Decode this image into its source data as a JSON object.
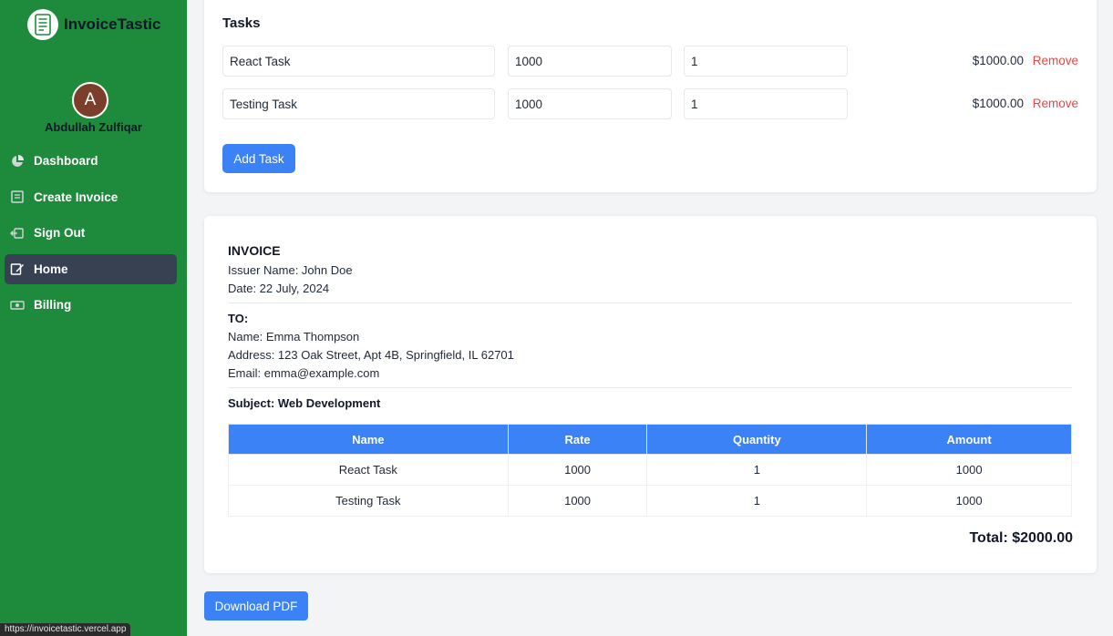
{
  "app": {
    "name": "InvoiceTastic"
  },
  "user": {
    "initial": "A",
    "name": "Abdullah Zulfiqar"
  },
  "nav": {
    "items": [
      {
        "label": "Dashboard",
        "icon": "pie-chart-icon"
      },
      {
        "label": "Create Invoice",
        "icon": "document-icon"
      },
      {
        "label": "Sign Out",
        "icon": "sign-out-icon"
      },
      {
        "label": "Home",
        "icon": "edit-icon",
        "active": true
      },
      {
        "label": "Billing",
        "icon": "money-icon"
      }
    ]
  },
  "tasks": {
    "title": "Tasks",
    "rows": [
      {
        "name": "React Task",
        "rate": "1000",
        "quantity": "1",
        "amount": "$1000.00",
        "remove_label": "Remove"
      },
      {
        "name": "Testing Task",
        "rate": "1000",
        "quantity": "1",
        "amount": "$1000.00",
        "remove_label": "Remove"
      }
    ],
    "add_label": "Add Task"
  },
  "invoice": {
    "title": "INVOICE",
    "issuer": "Issuer Name: John Doe",
    "date": "Date: 22 July, 2024",
    "to_label": "TO:",
    "to_name": "Name: Emma Thompson",
    "to_address": "Address: 123 Oak Street, Apt 4B, Springfield, IL 62701",
    "to_email": "Email: emma@example.com",
    "subject": "Subject: Web Development",
    "table": {
      "headers": [
        "Name",
        "Rate",
        "Quantity",
        "Amount"
      ],
      "rows": [
        [
          "React Task",
          "1000",
          "1",
          "1000"
        ],
        [
          "Testing Task",
          "1000",
          "1",
          "1000"
        ]
      ]
    },
    "total": "Total: $2000.00"
  },
  "download_label": "Download PDF",
  "status_url": "https://invoicetastic.vercel.app",
  "colors": {
    "sidebar": "#1e8a3b",
    "active_nav": "#374151",
    "primary": "#3b82f6",
    "danger": "#ef4444"
  }
}
